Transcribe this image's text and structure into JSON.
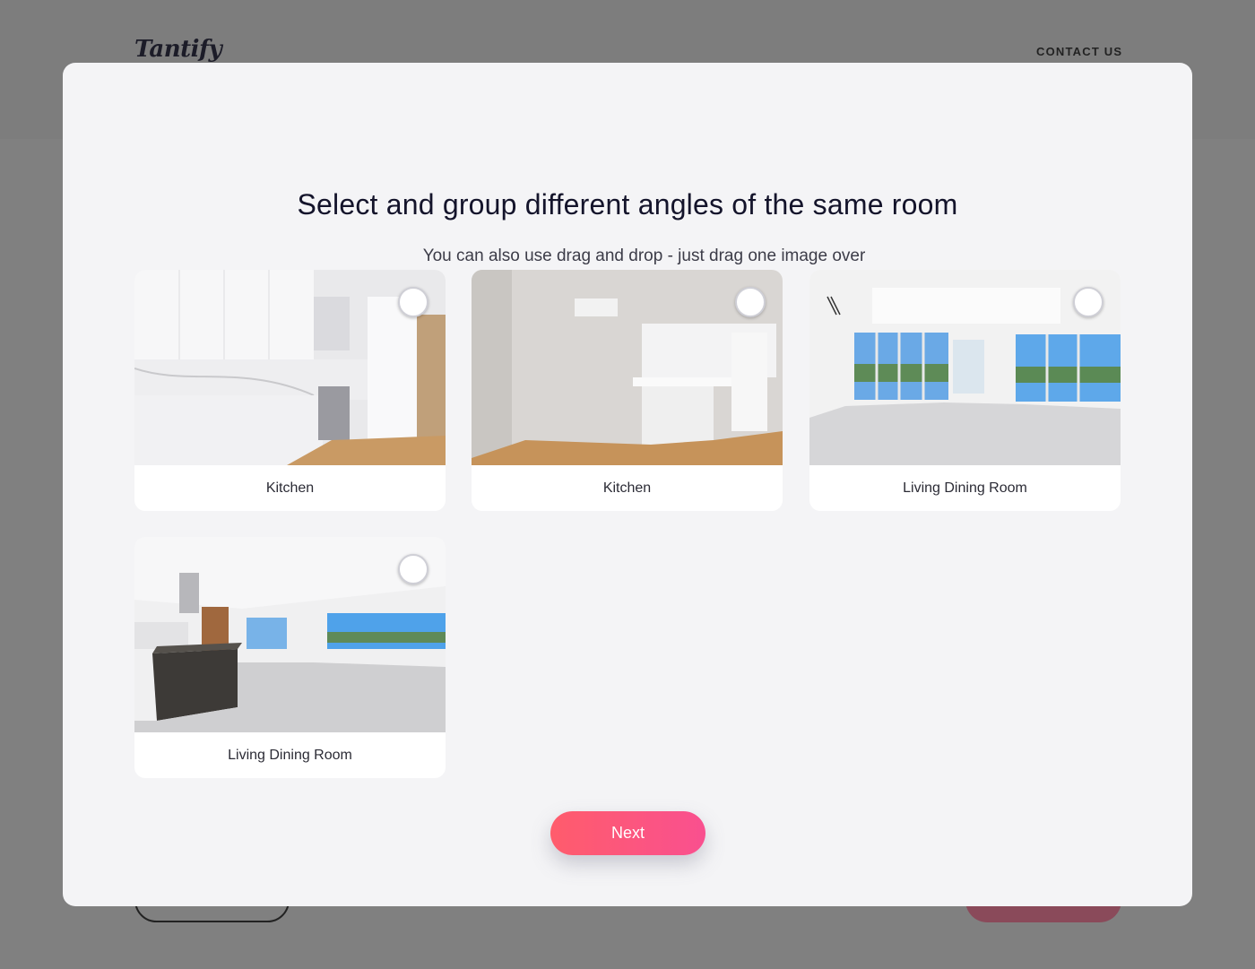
{
  "background": {
    "logo": "Tantify",
    "contact_label": "CONTACT US"
  },
  "modal": {
    "title": "Select and group different angles of the same room",
    "subtitle": "You can also use drag and drop - just drag one image over another to group them.",
    "next_label": "Next",
    "accent_gradient": [
      "#ff5c6c",
      "#f9508f"
    ]
  },
  "photos": [
    {
      "label": "Kitchen",
      "selected": false
    },
    {
      "label": "Kitchen",
      "selected": false
    },
    {
      "label": "Living Dining Room",
      "selected": false
    },
    {
      "label": "Living Dining Room",
      "selected": false
    }
  ]
}
